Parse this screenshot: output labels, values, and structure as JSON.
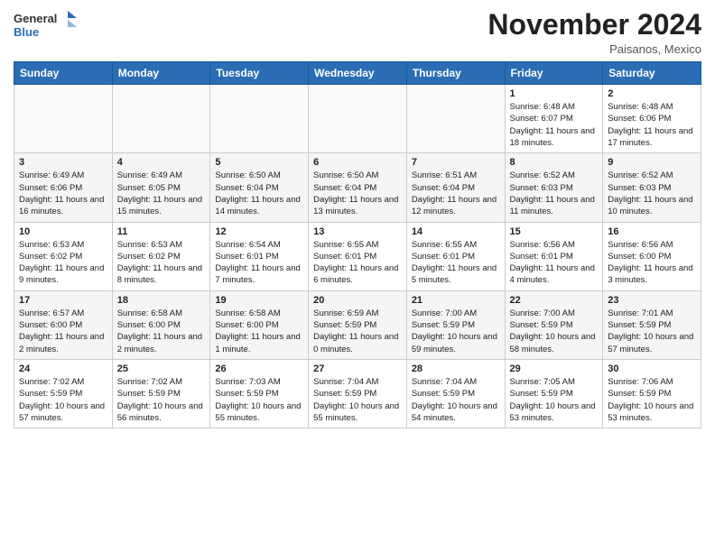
{
  "header": {
    "logo_general": "General",
    "logo_blue": "Blue",
    "month_title": "November 2024",
    "location": "Paisanos, Mexico"
  },
  "days_of_week": [
    "Sunday",
    "Monday",
    "Tuesday",
    "Wednesday",
    "Thursday",
    "Friday",
    "Saturday"
  ],
  "weeks": [
    [
      {
        "day": "",
        "info": ""
      },
      {
        "day": "",
        "info": ""
      },
      {
        "day": "",
        "info": ""
      },
      {
        "day": "",
        "info": ""
      },
      {
        "day": "",
        "info": ""
      },
      {
        "day": "1",
        "info": "Sunrise: 6:48 AM\nSunset: 6:07 PM\nDaylight: 11 hours and 18 minutes."
      },
      {
        "day": "2",
        "info": "Sunrise: 6:48 AM\nSunset: 6:06 PM\nDaylight: 11 hours and 17 minutes."
      }
    ],
    [
      {
        "day": "3",
        "info": "Sunrise: 6:49 AM\nSunset: 6:06 PM\nDaylight: 11 hours and 16 minutes."
      },
      {
        "day": "4",
        "info": "Sunrise: 6:49 AM\nSunset: 6:05 PM\nDaylight: 11 hours and 15 minutes."
      },
      {
        "day": "5",
        "info": "Sunrise: 6:50 AM\nSunset: 6:04 PM\nDaylight: 11 hours and 14 minutes."
      },
      {
        "day": "6",
        "info": "Sunrise: 6:50 AM\nSunset: 6:04 PM\nDaylight: 11 hours and 13 minutes."
      },
      {
        "day": "7",
        "info": "Sunrise: 6:51 AM\nSunset: 6:04 PM\nDaylight: 11 hours and 12 minutes."
      },
      {
        "day": "8",
        "info": "Sunrise: 6:52 AM\nSunset: 6:03 PM\nDaylight: 11 hours and 11 minutes."
      },
      {
        "day": "9",
        "info": "Sunrise: 6:52 AM\nSunset: 6:03 PM\nDaylight: 11 hours and 10 minutes."
      }
    ],
    [
      {
        "day": "10",
        "info": "Sunrise: 6:53 AM\nSunset: 6:02 PM\nDaylight: 11 hours and 9 minutes."
      },
      {
        "day": "11",
        "info": "Sunrise: 6:53 AM\nSunset: 6:02 PM\nDaylight: 11 hours and 8 minutes."
      },
      {
        "day": "12",
        "info": "Sunrise: 6:54 AM\nSunset: 6:01 PM\nDaylight: 11 hours and 7 minutes."
      },
      {
        "day": "13",
        "info": "Sunrise: 6:55 AM\nSunset: 6:01 PM\nDaylight: 11 hours and 6 minutes."
      },
      {
        "day": "14",
        "info": "Sunrise: 6:55 AM\nSunset: 6:01 PM\nDaylight: 11 hours and 5 minutes."
      },
      {
        "day": "15",
        "info": "Sunrise: 6:56 AM\nSunset: 6:01 PM\nDaylight: 11 hours and 4 minutes."
      },
      {
        "day": "16",
        "info": "Sunrise: 6:56 AM\nSunset: 6:00 PM\nDaylight: 11 hours and 3 minutes."
      }
    ],
    [
      {
        "day": "17",
        "info": "Sunrise: 6:57 AM\nSunset: 6:00 PM\nDaylight: 11 hours and 2 minutes."
      },
      {
        "day": "18",
        "info": "Sunrise: 6:58 AM\nSunset: 6:00 PM\nDaylight: 11 hours and 2 minutes."
      },
      {
        "day": "19",
        "info": "Sunrise: 6:58 AM\nSunset: 6:00 PM\nDaylight: 11 hours and 1 minute."
      },
      {
        "day": "20",
        "info": "Sunrise: 6:59 AM\nSunset: 5:59 PM\nDaylight: 11 hours and 0 minutes."
      },
      {
        "day": "21",
        "info": "Sunrise: 7:00 AM\nSunset: 5:59 PM\nDaylight: 10 hours and 59 minutes."
      },
      {
        "day": "22",
        "info": "Sunrise: 7:00 AM\nSunset: 5:59 PM\nDaylight: 10 hours and 58 minutes."
      },
      {
        "day": "23",
        "info": "Sunrise: 7:01 AM\nSunset: 5:59 PM\nDaylight: 10 hours and 57 minutes."
      }
    ],
    [
      {
        "day": "24",
        "info": "Sunrise: 7:02 AM\nSunset: 5:59 PM\nDaylight: 10 hours and 57 minutes."
      },
      {
        "day": "25",
        "info": "Sunrise: 7:02 AM\nSunset: 5:59 PM\nDaylight: 10 hours and 56 minutes."
      },
      {
        "day": "26",
        "info": "Sunrise: 7:03 AM\nSunset: 5:59 PM\nDaylight: 10 hours and 55 minutes."
      },
      {
        "day": "27",
        "info": "Sunrise: 7:04 AM\nSunset: 5:59 PM\nDaylight: 10 hours and 55 minutes."
      },
      {
        "day": "28",
        "info": "Sunrise: 7:04 AM\nSunset: 5:59 PM\nDaylight: 10 hours and 54 minutes."
      },
      {
        "day": "29",
        "info": "Sunrise: 7:05 AM\nSunset: 5:59 PM\nDaylight: 10 hours and 53 minutes."
      },
      {
        "day": "30",
        "info": "Sunrise: 7:06 AM\nSunset: 5:59 PM\nDaylight: 10 hours and 53 minutes."
      }
    ]
  ]
}
